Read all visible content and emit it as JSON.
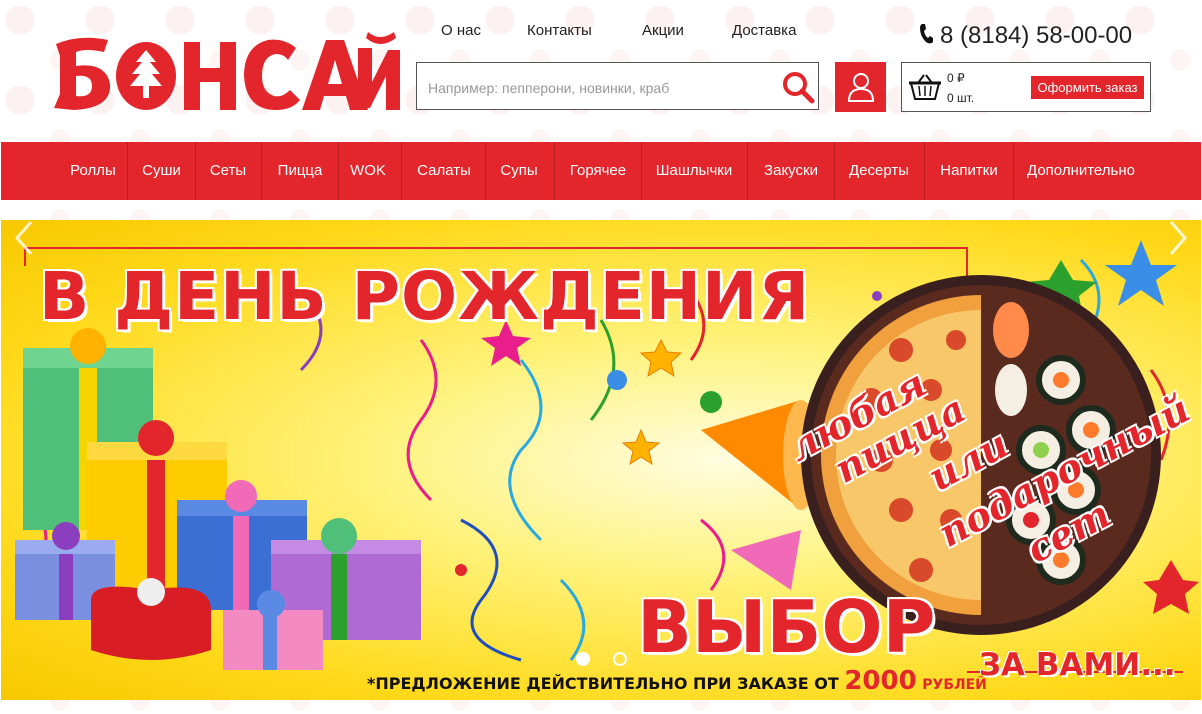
{
  "brand": {
    "logo_text": "БОНСАЙ",
    "accent_color": "#e3262c"
  },
  "top_nav": {
    "items": [
      {
        "label": "О нас"
      },
      {
        "label": "Контакты"
      },
      {
        "label": "Акции"
      },
      {
        "label": "Доставка"
      }
    ]
  },
  "phone": {
    "icon": "phone-icon",
    "number": "8 (8184) 58-00-00"
  },
  "search": {
    "placeholder": "Например: пепперони, новинки, краб",
    "value": "",
    "icon": "search-icon"
  },
  "user": {
    "icon": "user-icon"
  },
  "cart": {
    "icon": "basket-icon",
    "sum": "0 ₽",
    "count": "0 шт.",
    "order_label": "Оформить заказ"
  },
  "main_nav": {
    "items": [
      {
        "label": "Роллы"
      },
      {
        "label": "Суши"
      },
      {
        "label": "Сеты"
      },
      {
        "label": "Пицца"
      },
      {
        "label": "WOK"
      },
      {
        "label": "Салаты"
      },
      {
        "label": "Супы"
      },
      {
        "label": "Горячее"
      },
      {
        "label": "Шашлычки"
      },
      {
        "label": "Закуски"
      },
      {
        "label": "Десерты"
      },
      {
        "label": "Напитки"
      },
      {
        "label": "Дополнительно"
      }
    ]
  },
  "banner": {
    "headline": "В ДЕНЬ РОЖДЕНИЯ",
    "script_lines": [
      "любая",
      "пицца",
      "или",
      "подарочный",
      "сет"
    ],
    "choice": "ВЫБОР",
    "yours": "ЗА ВАМИ...",
    "offer_prefix": "*ПРЕДЛОЖЕНИЕ ДЕЙСТВИТЕЛЬНО ПРИ ЗАКАЗЕ ОТ",
    "offer_amount": "2000",
    "offer_currency": "РУБЛЕЙ",
    "slide_count": 2,
    "active_slide": 1
  }
}
